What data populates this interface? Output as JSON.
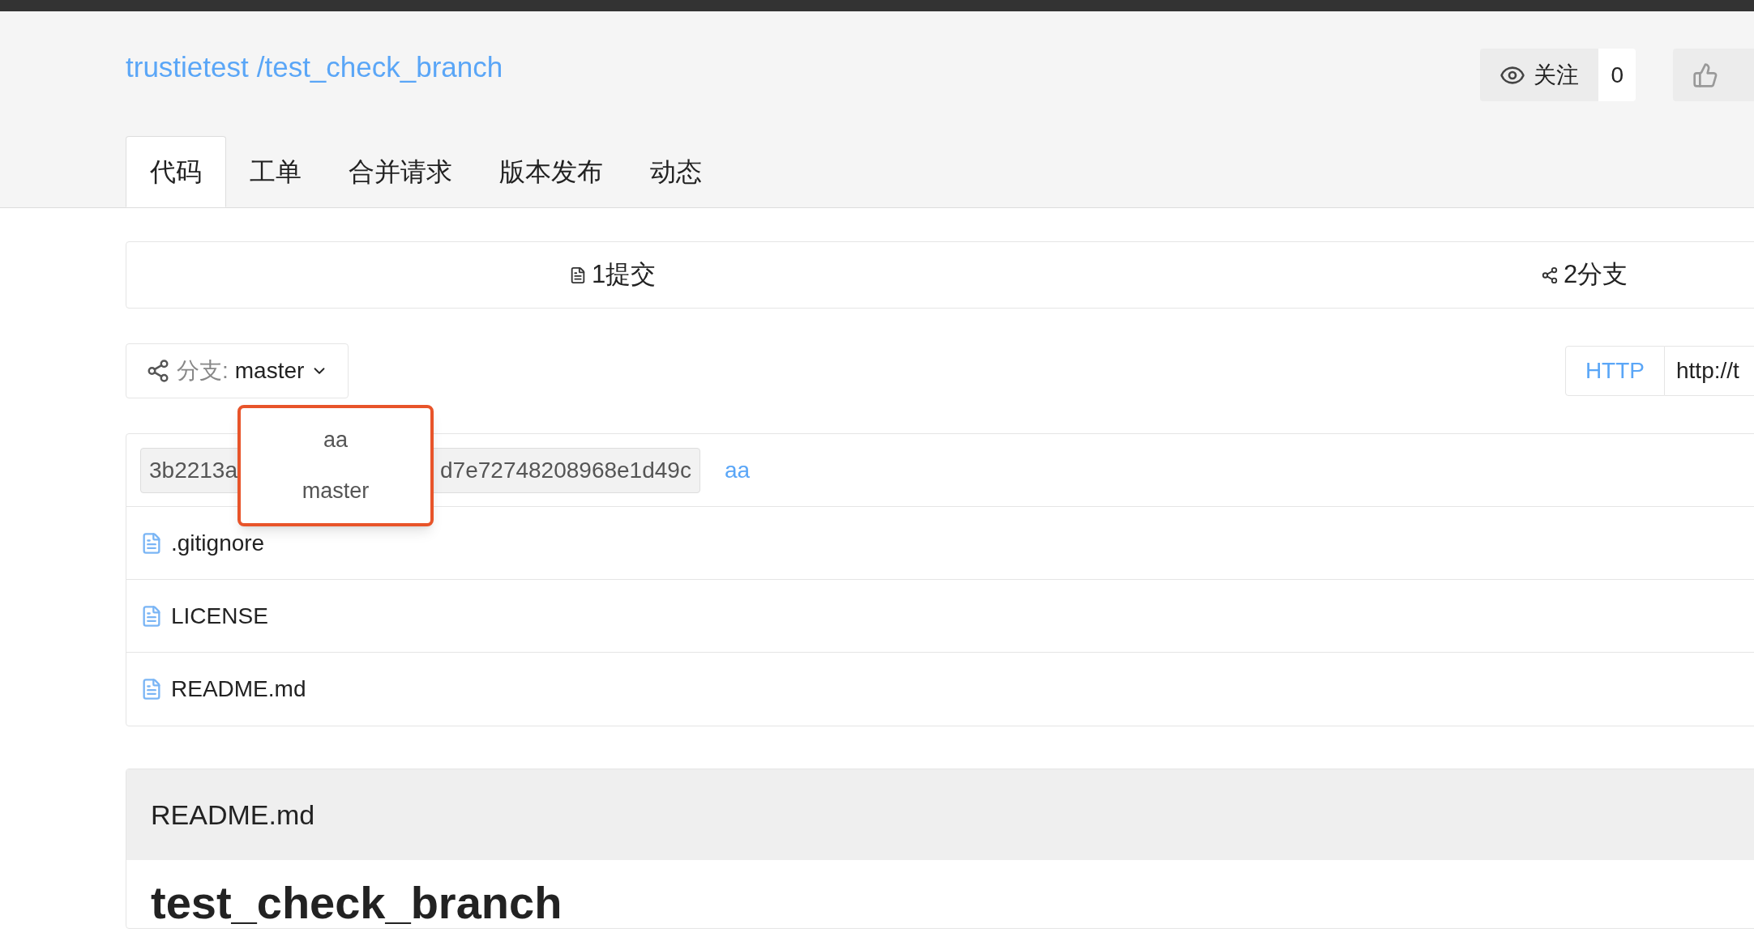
{
  "repo": {
    "owner": "trustietest",
    "name": "/test_check_branch"
  },
  "watch": {
    "label": "关注",
    "count": "0"
  },
  "tabs": [
    {
      "label": "代码",
      "selected": true
    },
    {
      "label": "工单",
      "selected": false
    },
    {
      "label": "合并请求",
      "selected": false
    },
    {
      "label": "版本发布",
      "selected": false
    },
    {
      "label": "动态",
      "selected": false
    }
  ],
  "stats": [
    {
      "kind": "commits",
      "label": "1提交"
    },
    {
      "kind": "branches",
      "label": "2分支"
    }
  ],
  "branch_selector": {
    "prefix": "分支:",
    "value": "master"
  },
  "branch_dropdown": {
    "highlighted": true,
    "items": [
      "aa",
      "master"
    ]
  },
  "clone": {
    "protocol": "HTTP",
    "url": "http://t"
  },
  "commit": {
    "hash_start": "3b2213a",
    "hash_end": "d7e72748208968e1d49c",
    "message": "aa"
  },
  "files": [
    ".gitignore",
    "LICENSE",
    "README.md"
  ],
  "readme": {
    "title": "README.md",
    "heading": "test_check_branch"
  }
}
